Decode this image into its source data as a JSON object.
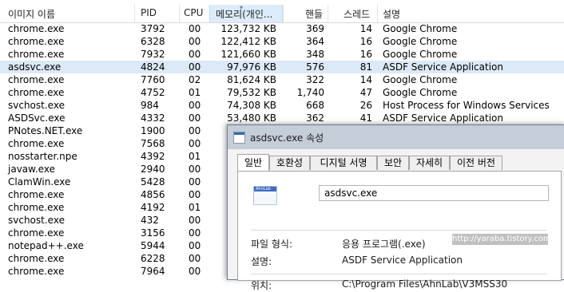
{
  "columns": {
    "name": "이미지 이름",
    "pid": "PID",
    "cpu": "CPU",
    "memory": "메모리(개인...",
    "handles": "핸들",
    "threads": "스레드",
    "description": "설명"
  },
  "processes": [
    {
      "name": "chrome.exe",
      "pid": "3792",
      "cpu": "00",
      "mem": "123,732 KB",
      "handles": "369",
      "threads": "14",
      "desc": "Google Chrome"
    },
    {
      "name": "chrome.exe",
      "pid": "6328",
      "cpu": "00",
      "mem": "122,412 KB",
      "handles": "364",
      "threads": "16",
      "desc": "Google Chrome"
    },
    {
      "name": "chrome.exe",
      "pid": "7932",
      "cpu": "00",
      "mem": "121,660 KB",
      "handles": "348",
      "threads": "16",
      "desc": "Google Chrome"
    },
    {
      "name": "asdsvc.exe",
      "pid": "4824",
      "cpu": "00",
      "mem": "97,976 KB",
      "handles": "576",
      "threads": "81",
      "desc": "ASDF Service Application"
    },
    {
      "name": "chrome.exe",
      "pid": "7760",
      "cpu": "02",
      "mem": "81,624 KB",
      "handles": "322",
      "threads": "14",
      "desc": "Google Chrome"
    },
    {
      "name": "chrome.exe",
      "pid": "4752",
      "cpu": "01",
      "mem": "79,532 KB",
      "handles": "1,740",
      "threads": "47",
      "desc": "Google Chrome"
    },
    {
      "name": "svchost.exe",
      "pid": "984",
      "cpu": "00",
      "mem": "74,308 KB",
      "handles": "668",
      "threads": "26",
      "desc": "Host Process for Windows Services"
    },
    {
      "name": "ASDSvc.exe",
      "pid": "4332",
      "cpu": "00",
      "mem": "53,480 KB",
      "handles": "362",
      "threads": "41",
      "desc": "ASDF Service Application"
    },
    {
      "name": "PNotes.NET.exe",
      "pid": "1900",
      "cpu": "00",
      "mem": "",
      "handles": "",
      "threads": "",
      "desc": ""
    },
    {
      "name": "chrome.exe",
      "pid": "7568",
      "cpu": "00",
      "mem": "",
      "handles": "",
      "threads": "",
      "desc": ""
    },
    {
      "name": "nosstarter.npe",
      "pid": "4392",
      "cpu": "01",
      "mem": "",
      "handles": "",
      "threads": "",
      "desc": ""
    },
    {
      "name": "javaw.exe",
      "pid": "2940",
      "cpu": "00",
      "mem": "",
      "handles": "",
      "threads": "",
      "desc": ""
    },
    {
      "name": "ClamWin.exe",
      "pid": "5428",
      "cpu": "00",
      "mem": "",
      "handles": "",
      "threads": "",
      "desc": ""
    },
    {
      "name": "chrome.exe",
      "pid": "4856",
      "cpu": "00",
      "mem": "",
      "handles": "",
      "threads": "",
      "desc": ""
    },
    {
      "name": "chrome.exe",
      "pid": "4192",
      "cpu": "01",
      "mem": "",
      "handles": "",
      "threads": "",
      "desc": ""
    },
    {
      "name": "svchost.exe",
      "pid": "432",
      "cpu": "00",
      "mem": "",
      "handles": "",
      "threads": "",
      "desc": ""
    },
    {
      "name": "chrome.exe",
      "pid": "3156",
      "cpu": "00",
      "mem": "",
      "handles": "",
      "threads": "",
      "desc": ""
    },
    {
      "name": "notepad++.exe",
      "pid": "5944",
      "cpu": "00",
      "mem": "",
      "handles": "",
      "threads": "",
      "desc": ""
    },
    {
      "name": "chrome.exe",
      "pid": "6228",
      "cpu": "00",
      "mem": "",
      "handles": "",
      "threads": "",
      "desc": ""
    },
    {
      "name": "chrome.exe",
      "pid": "7964",
      "cpu": "00",
      "mem": "",
      "handles": "",
      "threads": "",
      "desc": ""
    }
  ],
  "selected_row": 3,
  "dialog": {
    "title": "asdsvc.exe 속성",
    "tabs": [
      "일반",
      "호환성",
      "디지털 서명",
      "보안",
      "자세히",
      "이전 버전"
    ],
    "active_tab": "일반",
    "app_icon_text": "AhnLab",
    "file_name": "asdsvc.exe",
    "file_type_label": "파일 형식:",
    "file_type_value": "응용 프로그램(.exe)",
    "description_label": "설명:",
    "description_value": "ASDF Service Application",
    "location_label": "위치:",
    "location_value": "C:\\Program Files\\AhnLab\\V3MSS30"
  },
  "watermark": "http://yaraba.tistory.com",
  "colors": {
    "selection": "#dce9f7",
    "sorted_header": "#dcecfb",
    "dialog_title": "#c0cad6"
  }
}
